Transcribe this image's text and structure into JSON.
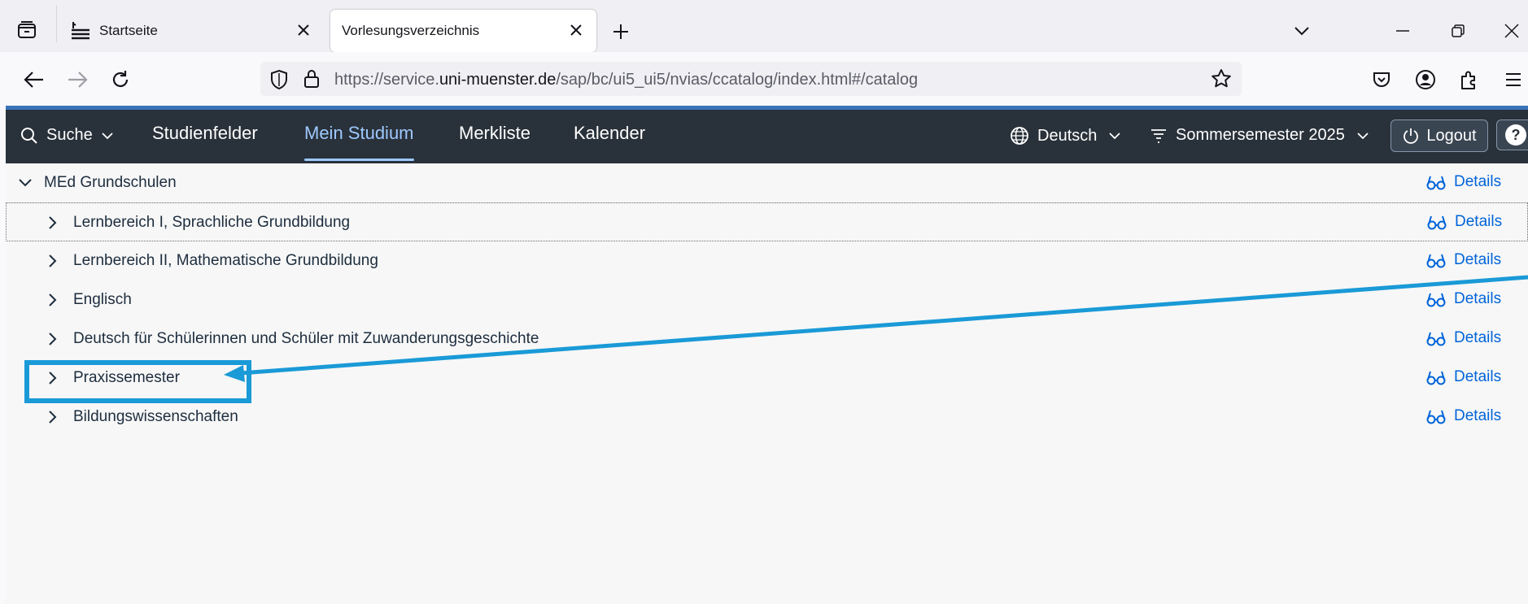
{
  "browser": {
    "tabs": [
      {
        "title": "Startseite",
        "active": false
      },
      {
        "title": "Vorlesungsverzeichnis",
        "active": true
      }
    ],
    "url": {
      "scheme": "https://service.",
      "host": "uni-muenster.de",
      "path": "/sap/bc/ui5_ui5/nvias/ccatalog/index.html#/catalog"
    }
  },
  "shell": {
    "search_label": "Suche",
    "nav": [
      "Studienfelder",
      "Mein Studium",
      "Merkliste",
      "Kalender"
    ],
    "selected_nav": "Mein Studium",
    "language": "Deutsch",
    "semester": "Sommersemester 2025",
    "logout_label": "Logout",
    "help_label": "?"
  },
  "tree": {
    "root": {
      "label": "MEd Grundschulen",
      "details": "Details",
      "expanded": true
    },
    "children": [
      {
        "label": "Lernbereich I, Sprachliche Grundbildung",
        "details": "Details"
      },
      {
        "label": "Lernbereich II, Mathematische Grundbildung",
        "details": "Details"
      },
      {
        "label": "Englisch",
        "details": "Details"
      },
      {
        "label": "Deutsch für Schülerinnen und Schüler mit Zuwanderungsgeschichte",
        "details": "Details"
      },
      {
        "label": "Praxissemester",
        "details": "Details"
      },
      {
        "label": "Bildungswissenschaften",
        "details": "Details"
      }
    ]
  },
  "colors": {
    "shell_bg": "#29313a",
    "selected_nav": "#9ec9ff",
    "link": "#0064d9",
    "annotation": "#1a9ad7"
  }
}
